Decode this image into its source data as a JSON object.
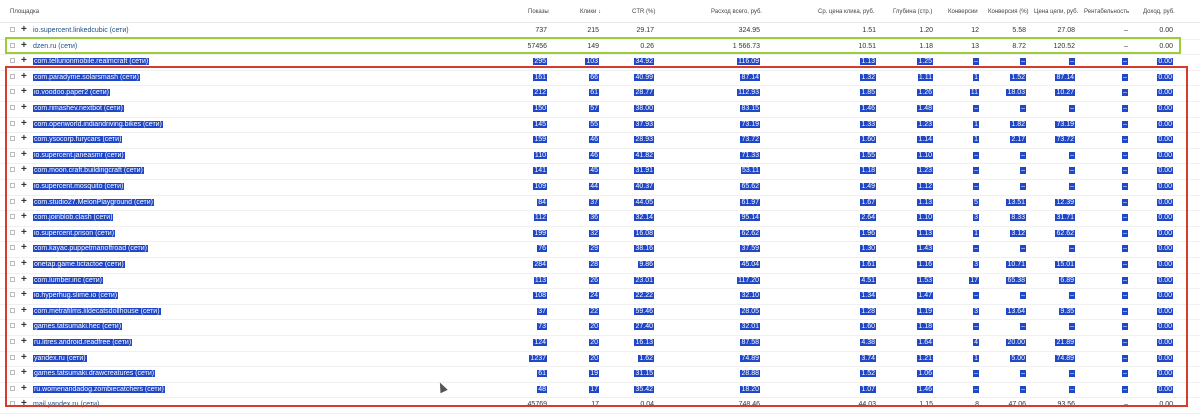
{
  "columns": {
    "site": "Площадка",
    "shows": "Показы",
    "clicks": "Клики ↓",
    "ctr": "CTR (%)",
    "spend": "Расход всего, руб.",
    "cpc": "Ср. цена клика, руб.",
    "depth": "Глубина (стр.)",
    "conversions": "Конверсии",
    "conv_rate": "Конверсия (%)",
    "goal_price": "Цена цели, руб.",
    "profitability": "Рентабельность",
    "income": "Доход, руб."
  },
  "rows": [
    {
      "site": "io.supercent.linkedcubic (сети)",
      "shows": "737",
      "clicks": "215",
      "ctr": "29.17",
      "spend": "324.95",
      "cpc": "1.51",
      "depth": "1.20",
      "conversions": "12",
      "conv_rate": "5.58",
      "goal_price": "27.08",
      "profitability": "–",
      "income": "0.00",
      "highlight": false
    },
    {
      "site": "dzen.ru (сети)",
      "shows": "57456",
      "clicks": "149",
      "ctr": "0.26",
      "spend": "1 566.73",
      "cpc": "10.51",
      "depth": "1.18",
      "conversions": "13",
      "conv_rate": "8.72",
      "goal_price": "120.52",
      "profitability": "–",
      "income": "0.00",
      "highlight": false
    },
    {
      "site": "com.tellurionmobile.realmcraft (сети)",
      "shows": "295",
      "clicks": "103",
      "ctr": "34.92",
      "spend": "116.09",
      "cpc": "1.13",
      "depth": "1.25",
      "conversions": "–",
      "conv_rate": "–",
      "goal_price": "–",
      "profitability": "–",
      "income": "0.00",
      "highlight": true
    },
    {
      "site": "com.paradyme.solarsmash (сети)",
      "shows": "161",
      "clicks": "66",
      "ctr": "40.99",
      "spend": "87.14",
      "cpc": "1.32",
      "depth": "1.11",
      "conversions": "1",
      "conv_rate": "1.52",
      "goal_price": "87.14",
      "profitability": "–",
      "income": "0.00",
      "highlight": true
    },
    {
      "site": "io.voodoo.paper2 (сети)",
      "shows": "212",
      "clicks": "61",
      "ctr": "28.77",
      "spend": "112.93",
      "cpc": "1.85",
      "depth": "1.26",
      "conversions": "11",
      "conv_rate": "18.03",
      "goal_price": "10.27",
      "profitability": "–",
      "income": "0.00",
      "highlight": true
    },
    {
      "site": "com.rimashev.nextbot (сети)",
      "shows": "150",
      "clicks": "57",
      "ctr": "38.00",
      "spend": "83.15",
      "cpc": "1.46",
      "depth": "1.48",
      "conversions": "–",
      "conv_rate": "–",
      "goal_price": "–",
      "profitability": "–",
      "income": "0.00",
      "highlight": true
    },
    {
      "site": "com.openworld.indiandriving.bikes (сети)",
      "shows": "145",
      "clicks": "55",
      "ctr": "37.93",
      "spend": "73.19",
      "cpc": "1.33",
      "depth": "1.23",
      "conversions": "1",
      "conv_rate": "1.82",
      "goal_price": "73.19",
      "profitability": "–",
      "income": "0.00",
      "highlight": true
    },
    {
      "site": "com.ysocorp.furycars (сети)",
      "shows": "159",
      "clicks": "46",
      "ctr": "28.93",
      "spend": "73.72",
      "cpc": "1.60",
      "depth": "1.14",
      "conversions": "1",
      "conv_rate": "2.17",
      "goal_price": "73.72",
      "profitability": "–",
      "income": "0.00",
      "highlight": true
    },
    {
      "site": "io.supercent.janeasmr (сети)",
      "shows": "110",
      "clicks": "46",
      "ctr": "41.82",
      "spend": "71.33",
      "cpc": "1.55",
      "depth": "1.10",
      "conversions": "–",
      "conv_rate": "–",
      "goal_price": "–",
      "profitability": "–",
      "income": "0.00",
      "highlight": true
    },
    {
      "site": "com.moon.craft.buildingcraft (сети)",
      "shows": "141",
      "clicks": "45",
      "ctr": "31.91",
      "spend": "53.11",
      "cpc": "1.18",
      "depth": "1.23",
      "conversions": "–",
      "conv_rate": "–",
      "goal_price": "–",
      "profitability": "–",
      "income": "0.00",
      "highlight": true
    },
    {
      "site": "io.supercent.mosquito (сети)",
      "shows": "109",
      "clicks": "44",
      "ctr": "40.37",
      "spend": "65.62",
      "cpc": "1.49",
      "depth": "1.12",
      "conversions": "–",
      "conv_rate": "–",
      "goal_price": "–",
      "profitability": "–",
      "income": "0.00",
      "highlight": true
    },
    {
      "site": "com.studio27.MelonPlayground (сети)",
      "shows": "84",
      "clicks": "37",
      "ctr": "44.05",
      "spend": "61.97",
      "cpc": "1.67",
      "depth": "1.13",
      "conversions": "5",
      "conv_rate": "13.51",
      "goal_price": "12.39",
      "profitability": "–",
      "income": "0.00",
      "highlight": true
    },
    {
      "site": "com.joinblob.clash (сети)",
      "shows": "112",
      "clicks": "36",
      "ctr": "32.14",
      "spend": "95.14",
      "cpc": "2.64",
      "depth": "1.10",
      "conversions": "3",
      "conv_rate": "8.33",
      "goal_price": "31.71",
      "profitability": "–",
      "income": "0.00",
      "highlight": true
    },
    {
      "site": "io.supercent.prison (сети)",
      "shows": "199",
      "clicks": "32",
      "ctr": "16.08",
      "spend": "62.62",
      "cpc": "1.96",
      "depth": "1.13",
      "conversions": "1",
      "conv_rate": "3.12",
      "goal_price": "62.62",
      "profitability": "–",
      "income": "0.00",
      "highlight": true
    },
    {
      "site": "com.kayac.puppetmanoffroad (сети)",
      "shows": "76",
      "clicks": "29",
      "ctr": "38.16",
      "spend": "37.59",
      "cpc": "1.30",
      "depth": "1.43",
      "conversions": "–",
      "conv_rate": "–",
      "goal_price": "–",
      "profitability": "–",
      "income": "0.00",
      "highlight": true
    },
    {
      "site": "onetap.game.tictactoe (сети)",
      "shows": "284",
      "clicks": "28",
      "ctr": "9.86",
      "spend": "45.04",
      "cpc": "1.61",
      "depth": "1.16",
      "conversions": "3",
      "conv_rate": "10.71",
      "goal_price": "15.01",
      "profitability": "–",
      "income": "0.00",
      "highlight": true
    },
    {
      "site": "com.lumber.inc (сети)",
      "shows": "113",
      "clicks": "26",
      "ctr": "23.01",
      "spend": "117.20",
      "cpc": "4.51",
      "depth": "1.53",
      "conversions": "17",
      "conv_rate": "65.38",
      "goal_price": "6.89",
      "profitability": "–",
      "income": "0.00",
      "highlight": true
    },
    {
      "site": "io.hyperhug.slime.io (сети)",
      "shows": "108",
      "clicks": "24",
      "ctr": "22.22",
      "spend": "32.10",
      "cpc": "1.34",
      "depth": "1.47",
      "conversions": "–",
      "conv_rate": "–",
      "goal_price": "–",
      "profitability": "–",
      "income": "0.00",
      "highlight": true
    },
    {
      "site": "com.metrafilms.lildecatsdollhouse (сети)",
      "shows": "37",
      "clicks": "22",
      "ctr": "59.46",
      "spend": "28.05",
      "cpc": "1.28",
      "depth": "1.19",
      "conversions": "3",
      "conv_rate": "13.64",
      "goal_price": "9.35",
      "profitability": "–",
      "income": "0.00",
      "highlight": true
    },
    {
      "site": "games.tatsumaki.hec (сети)",
      "shows": "73",
      "clicks": "20",
      "ctr": "27.40",
      "spend": "32.01",
      "cpc": "1.60",
      "depth": "1.18",
      "conversions": "–",
      "conv_rate": "–",
      "goal_price": "–",
      "profitability": "–",
      "income": "0.00",
      "highlight": true
    },
    {
      "site": "ru.litres.android.readfree (сети)",
      "shows": "124",
      "clicks": "20",
      "ctr": "16.13",
      "spend": "87.58",
      "cpc": "4.38",
      "depth": "1.64",
      "conversions": "4",
      "conv_rate": "20.00",
      "goal_price": "21.89",
      "profitability": "–",
      "income": "0.00",
      "highlight": true
    },
    {
      "site": "yandex.ru (сети)",
      "shows": "1237",
      "clicks": "20",
      "ctr": "1.62",
      "spend": "74.89",
      "cpc": "3.74",
      "depth": "1.21",
      "conversions": "1",
      "conv_rate": "5.00",
      "goal_price": "74.89",
      "profitability": "–",
      "income": "0.00",
      "highlight": true
    },
    {
      "site": "games.tatsumaki.drawcreatures (сети)",
      "shows": "61",
      "clicks": "19",
      "ctr": "31.15",
      "spend": "28.88",
      "cpc": "1.52",
      "depth": "1.06",
      "conversions": "–",
      "conv_rate": "–",
      "goal_price": "–",
      "profitability": "–",
      "income": "0.00",
      "highlight": true
    },
    {
      "site": "ru.womenandadog.zombiecatchers (сети)",
      "shows": "48",
      "clicks": "17",
      "ctr": "35.42",
      "spend": "18.20",
      "cpc": "1.07",
      "depth": "1.46",
      "conversions": "–",
      "conv_rate": "–",
      "goal_price": "–",
      "profitability": "–",
      "income": "0.00",
      "highlight": true
    },
    {
      "site": "mail.yandex.ru (сети)",
      "shows": "45769",
      "clicks": "17",
      "ctr": "0.04",
      "spend": "748.46",
      "cpc": "44.03",
      "depth": "1.15",
      "conversions": "8",
      "conv_rate": "47.06",
      "goal_price": "93.56",
      "profitability": "–",
      "income": "0.00",
      "highlight": "partial"
    }
  ],
  "colors": {
    "selection": "#1f47c8",
    "green_frame": "#9ccc3a",
    "red_frame": "#d43c2c",
    "link": "#1a4f8b"
  },
  "icons": [
    "checkbox-icon",
    "expand-plus-icon",
    "mouse-cursor-icon"
  ]
}
